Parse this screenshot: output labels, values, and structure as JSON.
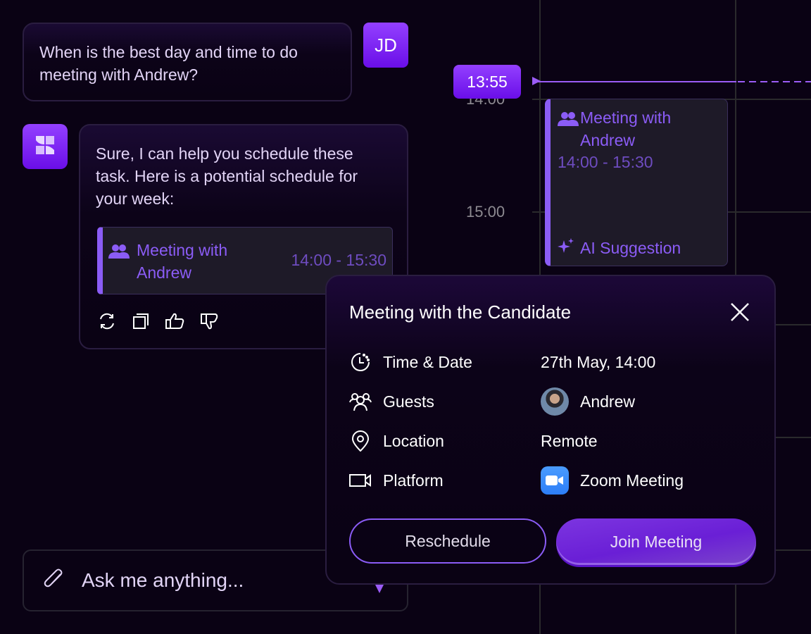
{
  "calendar": {
    "hours": [
      "14:00",
      "15:00"
    ],
    "current_time": "13:55",
    "event": {
      "title_line1": "Meeting with",
      "title_line2": "Andrew",
      "time": "14:00 - 15:30",
      "tag": "AI Suggestion",
      "icon": "people-icon",
      "tag_icon": "sparkle-icon"
    }
  },
  "chat": {
    "user": {
      "avatar_initials": "JD",
      "message": "When is the best day and time to do meeting with Andrew?"
    },
    "assistant": {
      "avatar_icon": "app-logo-icon",
      "message": "Sure, I can help you schedule these task. Here is a potential schedule for your week:",
      "event": {
        "title_line1": "Meeting with",
        "title_line2": "Andrew",
        "time": "14:00 - 15:30",
        "icon": "people-icon"
      },
      "actions": [
        {
          "name": "regenerate",
          "icon": "refresh-icon"
        },
        {
          "name": "copy",
          "icon": "copy-icon"
        },
        {
          "name": "like",
          "icon": "thumbs-up-icon"
        },
        {
          "name": "dislike",
          "icon": "thumbs-down-icon"
        }
      ]
    },
    "input": {
      "placeholder": "Ask me anything...",
      "value": "",
      "attach_icon": "paperclip-icon"
    }
  },
  "popup": {
    "title": "Meeting with the Candidate",
    "rows": [
      {
        "label": "Time & Date",
        "value": "27th May, 14:00",
        "icon": "clock-icon"
      },
      {
        "label": "Guests",
        "value": "Andrew",
        "icon": "guests-icon"
      },
      {
        "label": "Location",
        "value": "Remote",
        "icon": "location-pin-icon"
      },
      {
        "label": "Platform",
        "value": "Zoom Meeting",
        "icon": "video-camera-icon"
      }
    ],
    "reschedule_label": "Reschedule",
    "join_label": "Join Meeting"
  },
  "colors": {
    "background": "#0a0214",
    "accent": "#8b5cf6",
    "accent_strong": "#7c3aed",
    "zoom_blue": "#2d7ef7"
  }
}
